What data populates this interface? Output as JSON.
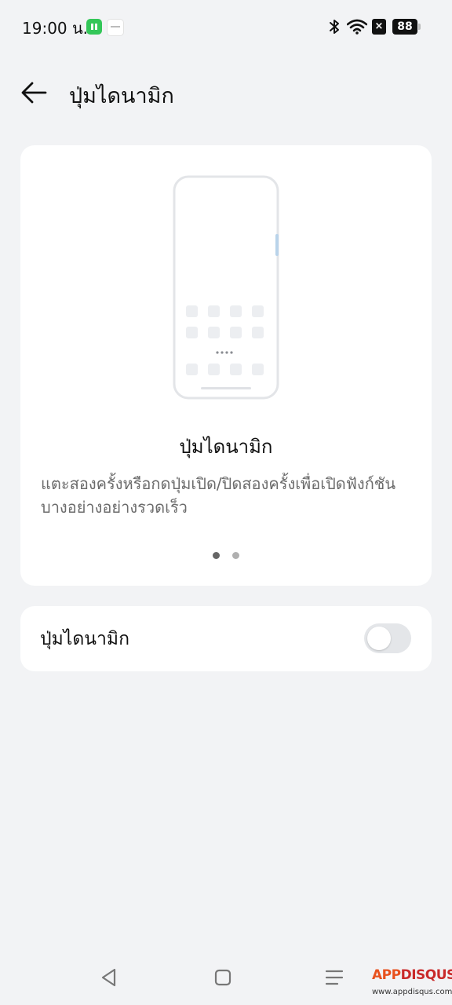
{
  "status_bar": {
    "time": "19:00 น.",
    "battery_level": "88",
    "sim_status": "×"
  },
  "header": {
    "title": "ปุ่มไดนามิก"
  },
  "hero_card": {
    "heading": "ปุ่มไดนามิก",
    "description": "แตะสองครั้งหรือกดปุ่มเปิด/ปิดสองครั้งเพื่อเปิดฟังก์ชันบางอย่างอย่างรวดเร็ว",
    "pager": {
      "current_page": 1,
      "total_pages": 2
    }
  },
  "setting": {
    "label": "ปุ่มไดนามิก",
    "toggle_on": false
  },
  "watermark": {
    "logo_main": "APP",
    "logo_accent": "DISQUS",
    "url": "www.appdisqus.com"
  },
  "colors": {
    "background": "#f2f3f5",
    "card": "#ffffff",
    "toggle_track": "#e4e6e9",
    "illustration_accent": "#b9d3ea"
  },
  "icons": {
    "back": "arrow-left-icon",
    "bluetooth": "bluetooth-icon",
    "wifi": "wifi-icon",
    "nav_back": "triangle-back-icon",
    "nav_home": "square-home-icon",
    "nav_recents": "menu-lines-icon"
  }
}
